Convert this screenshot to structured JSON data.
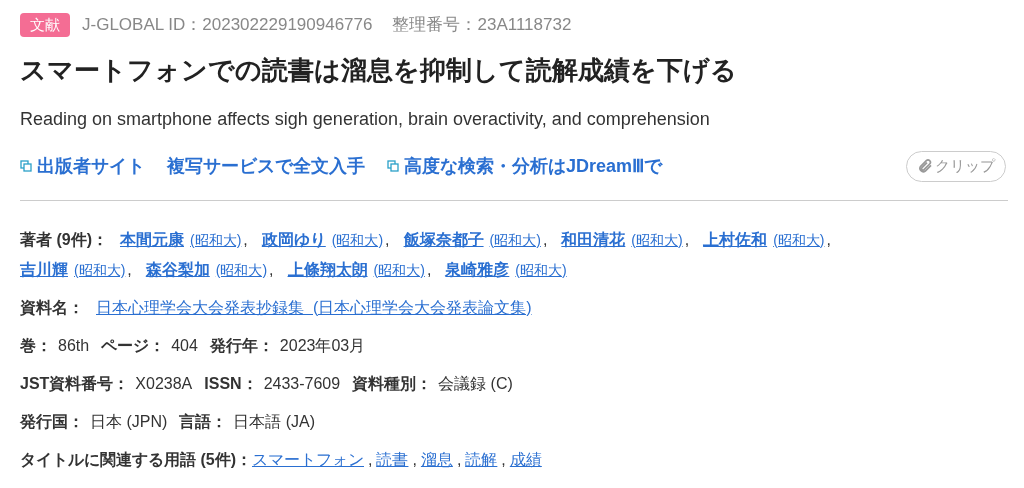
{
  "header": {
    "badge": "文献",
    "id_label": "J-GLOBAL ID：",
    "id_value": "202302229190946776",
    "ref_label": "整理番号：",
    "ref_value": "23A1118732"
  },
  "title": "スマートフォンでの読書は溜息を抑制して読解成績を下げる",
  "subtitle": "Reading on smartphone affects sigh generation, brain overactivity, and comprehension",
  "links": [
    {
      "label": "出版者サイト",
      "external": true
    },
    {
      "label": "複写サービスで全文入手",
      "external": false
    },
    {
      "label": "高度な検索・分析はJDreamⅢで",
      "external": true
    }
  ],
  "clip_button": "クリップ",
  "authors": {
    "label": "著者 (9件)：",
    "separator": ",",
    "items": [
      {
        "name": "本間元康",
        "affiliation": "(昭和大)"
      },
      {
        "name": "政岡ゆり",
        "affiliation": "(昭和大)"
      },
      {
        "name": "飯塚奈都子",
        "affiliation": "(昭和大)"
      },
      {
        "name": "和田清花",
        "affiliation": "(昭和大)"
      },
      {
        "name": "上村佐和",
        "affiliation": "(昭和大)"
      },
      {
        "name": "吉川輝",
        "affiliation": "(昭和大)"
      },
      {
        "name": "森谷梨加",
        "affiliation": "(昭和大)"
      },
      {
        "name": "上條翔太朗",
        "affiliation": "(昭和大)"
      },
      {
        "name": "泉崎雅彦",
        "affiliation": "(昭和大)"
      }
    ]
  },
  "source": {
    "label": "資料名：",
    "value": "日本心理学会大会発表抄録集  (日本心理学会大会発表論文集)"
  },
  "info_rows": [
    [
      {
        "label": "巻：",
        "value": "86th"
      },
      {
        "label": "ページ：",
        "value": "404"
      },
      {
        "label": "発行年：",
        "value": "2023年03月"
      }
    ],
    [
      {
        "label": "JST資料番号：",
        "value": "X0238A"
      },
      {
        "label": "ISSN：",
        "value": "2433-7609"
      },
      {
        "label": "資料種別：",
        "value": "会議録 (C)"
      }
    ],
    [
      {
        "label": "発行国：",
        "value": "日本 (JPN)"
      },
      {
        "label": "言語：",
        "value": "日本語 (JA)"
      }
    ]
  ],
  "terms": {
    "label": "タイトルに関連する用語 (5件)：",
    "separator": ",",
    "items": [
      "スマートフォン",
      "読書",
      "溜息",
      "読解",
      "成績"
    ]
  }
}
